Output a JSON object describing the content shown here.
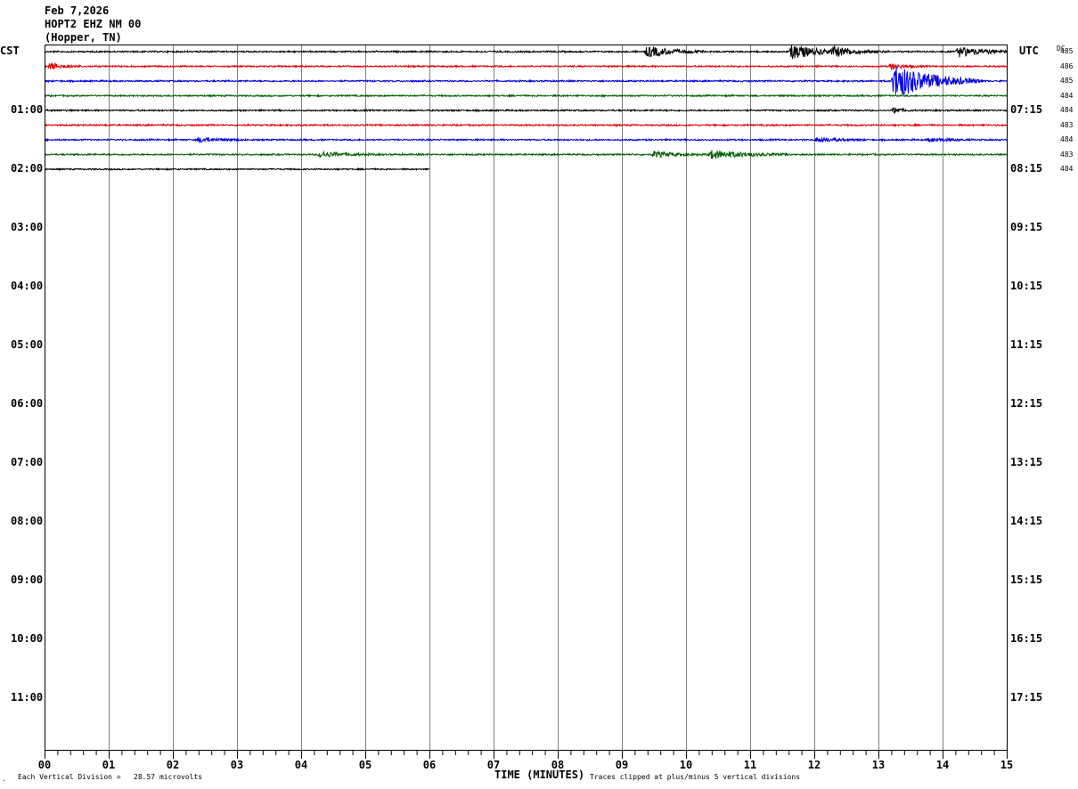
{
  "header": {
    "date": "Feb 7,2026",
    "station": "HOPT2 EHZ NM 00",
    "location": "(Hopper, TN)"
  },
  "left_tz": "CST",
  "right_tz": "UTC",
  "dc_label": "DC",
  "footer": {
    "scale_note": "Each Vertical Division =   28.57 microvolts",
    "clip_note": "Traces clipped at plus/minus 5 vertical divisions",
    "corner_mark": "."
  },
  "colors": {
    "trace_cycle": [
      "#000000",
      "#e00000",
      "#0000e0",
      "#006000"
    ],
    "grid": "#808080",
    "frame": "#000000"
  },
  "chart_data": {
    "type": "line",
    "title": "",
    "xlabel": "TIME (MINUTES)",
    "ylabel": "",
    "x_range": [
      0,
      15
    ],
    "x_ticks": [
      "00",
      "01",
      "02",
      "03",
      "04",
      "05",
      "06",
      "07",
      "08",
      "09",
      "10",
      "11",
      "12",
      "13",
      "14",
      "15"
    ],
    "left_hour_labels": [
      "01:00",
      "02:00",
      "03:00",
      "04:00",
      "05:00",
      "06:00",
      "07:00",
      "08:00",
      "09:00",
      "10:00",
      "11:00"
    ],
    "right_hour_labels": [
      "07:15",
      "08:15",
      "09:15",
      "10:15",
      "11:15",
      "12:15",
      "13:15",
      "14:15",
      "15:15",
      "16:15",
      "17:15"
    ],
    "rows_per_hour": 4,
    "total_rows": 48,
    "traces": [
      {
        "row": 0,
        "dc": "485",
        "end_min": 15,
        "noise": 0.25,
        "events": [
          {
            "t": 9.4,
            "amp": 1.6,
            "dur": 0.35
          },
          {
            "t": 11.65,
            "amp": 2.0,
            "dur": 0.4
          },
          {
            "t": 12.3,
            "amp": 1.1,
            "dur": 0.35
          },
          {
            "t": 14.25,
            "amp": 1.4,
            "dur": 0.35
          }
        ]
      },
      {
        "row": 1,
        "dc": "486",
        "end_min": 15,
        "noise": 0.25,
        "events": [
          {
            "t": 0.1,
            "amp": 0.9,
            "dur": 0.2
          },
          {
            "t": 13.2,
            "amp": 0.8,
            "dur": 0.2
          }
        ]
      },
      {
        "row": 2,
        "dc": "485",
        "end_min": 15,
        "noise": 0.25,
        "events": [
          {
            "t": 13.25,
            "amp": 5.0,
            "dur": 0.55
          }
        ]
      },
      {
        "row": 3,
        "dc": "484",
        "end_min": 15,
        "noise": 0.25,
        "events": []
      },
      {
        "row": 4,
        "dc": "484",
        "end_min": 15,
        "noise": 0.25,
        "events": [
          {
            "t": 13.25,
            "amp": 1.0,
            "dur": 0.1
          }
        ]
      },
      {
        "row": 5,
        "dc": "483",
        "end_min": 15,
        "noise": 0.25,
        "events": []
      },
      {
        "row": 6,
        "dc": "484",
        "end_min": 15,
        "noise": 0.25,
        "events": [
          {
            "t": 2.4,
            "amp": 0.7,
            "dur": 0.3
          },
          {
            "t": 12.05,
            "amp": 0.7,
            "dur": 0.3
          },
          {
            "t": 13.8,
            "amp": 0.6,
            "dur": 0.25
          }
        ]
      },
      {
        "row": 7,
        "dc": "483",
        "end_min": 15,
        "noise": 0.25,
        "events": [
          {
            "t": 4.3,
            "amp": 0.8,
            "dur": 0.35
          },
          {
            "t": 9.5,
            "amp": 0.8,
            "dur": 0.35
          },
          {
            "t": 10.4,
            "amp": 1.2,
            "dur": 0.5
          }
        ]
      },
      {
        "row": 8,
        "dc": "484",
        "end_min": 6,
        "noise": 0.22,
        "events": []
      }
    ]
  }
}
